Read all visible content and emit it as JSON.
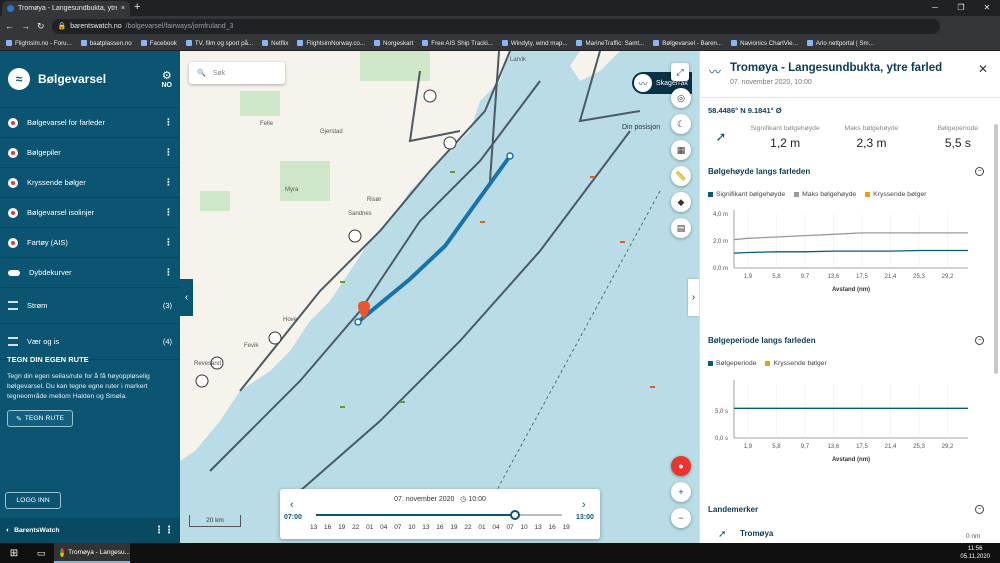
{
  "browser": {
    "tab_title": "Tromøya - Langesundbukta, ytre",
    "new_tab": "+",
    "url_host": "barentswatch.no",
    "url_path": "/bolgevarsel/fairways/jomfruland_3",
    "bookmarks": [
      "Flightsim.no - Foru...",
      "baatplassen.no",
      "Facebook",
      "TV, film og sport på...",
      "Netflix",
      "FlightsimNorway.co...",
      "Norgeskart",
      "Free AIS Ship Tracki...",
      "Windyty, wind map...",
      "MarineTraffic: Samt...",
      "Bølgevarsel - Baren...",
      "Navionics ChartVie...",
      "Arlo nettportal | Sm..."
    ]
  },
  "sidebar": {
    "title": "Bølgevarsel",
    "lang": "NO",
    "layers": [
      {
        "label": "Bølgevarsel for farleder",
        "count": ""
      },
      {
        "label": "Bølgepiler",
        "count": ""
      },
      {
        "label": "Kryssende bølger",
        "count": ""
      },
      {
        "label": "Bølgevarsel isolinjer",
        "count": ""
      },
      {
        "label": "Fartøy (AIS)",
        "count": ""
      },
      {
        "label": "Dybdekurver",
        "count": ""
      },
      {
        "label": "Strøm",
        "count": "(3)"
      },
      {
        "label": "Vær og is",
        "count": "(4)"
      }
    ],
    "route_title": "TEGN DIN EGEN RUTE",
    "route_desc": "Tegn din egen seilas/rute for å få høyoppløselig bølgevarsel. Du kan tegne egne ruter i markert tegneområde mellom Halden og Smøla.",
    "route_btn": "TEGN RUTE",
    "login": "LOGG INN",
    "brand": "BarentsWatch"
  },
  "map": {
    "search_placeholder": "Søk",
    "location_label": "Din posisjon",
    "skag_label": "Skagerrak",
    "scale": "20 km",
    "names": [
      "Larvik",
      "Felle",
      "Gjerstad",
      "Myra",
      "Sandnes",
      "Risør",
      "Hove",
      "Fevik",
      "Revesand"
    ]
  },
  "timeline": {
    "date": "07. november 2020",
    "time": "10:00",
    "start": "07:00",
    "end": "13:00",
    "hours": [
      "13",
      "16",
      "19",
      "22",
      "01",
      "04",
      "07",
      "10",
      "13",
      "16",
      "19",
      "22",
      "01",
      "04",
      "07",
      "10",
      "13",
      "16",
      "19"
    ],
    "progress": 0.81
  },
  "panel": {
    "title": "Tromøya - Langesundbukta, ytre farled",
    "subtitle": "07. november 2020, 10:00",
    "coords": "58.4486° N 9.1841° Ø",
    "stats": [
      {
        "label": "Signifikant bølgehøyde",
        "value": "1,2 m"
      },
      {
        "label": "Maks bølgehøyde",
        "value": "2,3 m"
      },
      {
        "label": "Bølgeperiode",
        "value": "5,5 s"
      }
    ],
    "section1": "Bølgehøyde langs farleden",
    "section2": "Bølgeperiode langs farleden",
    "section3": "Landemerker",
    "landmark": "Tromøya",
    "landmark_dist": "0 nm"
  },
  "colors": {
    "sidebar": "#0c5572",
    "accent": "#1a73a8",
    "series_sig": "#0d5a78",
    "series_max": "#999999",
    "series_cross": "#e0a020"
  },
  "chart_data": [
    {
      "type": "line",
      "title": "Bølgehøyde langs farleden",
      "xlabel": "Avstand (nm)",
      "ylabel": "",
      "categories": [
        "1,9",
        "5,8",
        "9,7",
        "13,6",
        "17,5",
        "21,4",
        "25,3",
        "29,2"
      ],
      "x": [
        0,
        1.9,
        5.8,
        9.7,
        13.6,
        17.5,
        21.4,
        25.3,
        29.2,
        32
      ],
      "yticks": [
        "0,0 m",
        "2,0 m",
        "4,0 m"
      ],
      "ylim": [
        0,
        4
      ],
      "series": [
        {
          "name": "Signifikant bølgehøyde",
          "values": [
            1.1,
            1.15,
            1.2,
            1.2,
            1.25,
            1.25,
            1.25,
            1.3,
            1.3,
            1.3
          ]
        },
        {
          "name": "Maks bølgehøyde",
          "values": [
            2.1,
            2.2,
            2.3,
            2.4,
            2.5,
            2.6,
            2.6,
            2.6,
            2.6,
            2.6
          ]
        },
        {
          "name": "Kryssende bølger",
          "values": []
        }
      ]
    },
    {
      "type": "line",
      "title": "Bølgeperiode langs farleden",
      "xlabel": "Avstand (nm)",
      "ylabel": "",
      "categories": [
        "1,9",
        "5,8",
        "9,7",
        "13,6",
        "17,5",
        "21,4",
        "25,3",
        "29,2"
      ],
      "x": [
        0,
        1.9,
        5.8,
        9.7,
        13.6,
        17.5,
        21.4,
        25.3,
        29.2,
        32
      ],
      "yticks": [
        "0,0 s",
        "5,0 s"
      ],
      "ylim": [
        0,
        10
      ],
      "series": [
        {
          "name": "Bølgeperiode",
          "values": [
            5.5,
            5.5,
            5.5,
            5.5,
            5.5,
            5.5,
            5.5,
            5.5,
            5.5,
            5.5
          ]
        },
        {
          "name": "Kryssende bølger",
          "values": []
        }
      ]
    }
  ],
  "taskbar": {
    "task_label": "Tromøya - Langesu...",
    "time": "11:56",
    "date": "05.11.2020"
  }
}
